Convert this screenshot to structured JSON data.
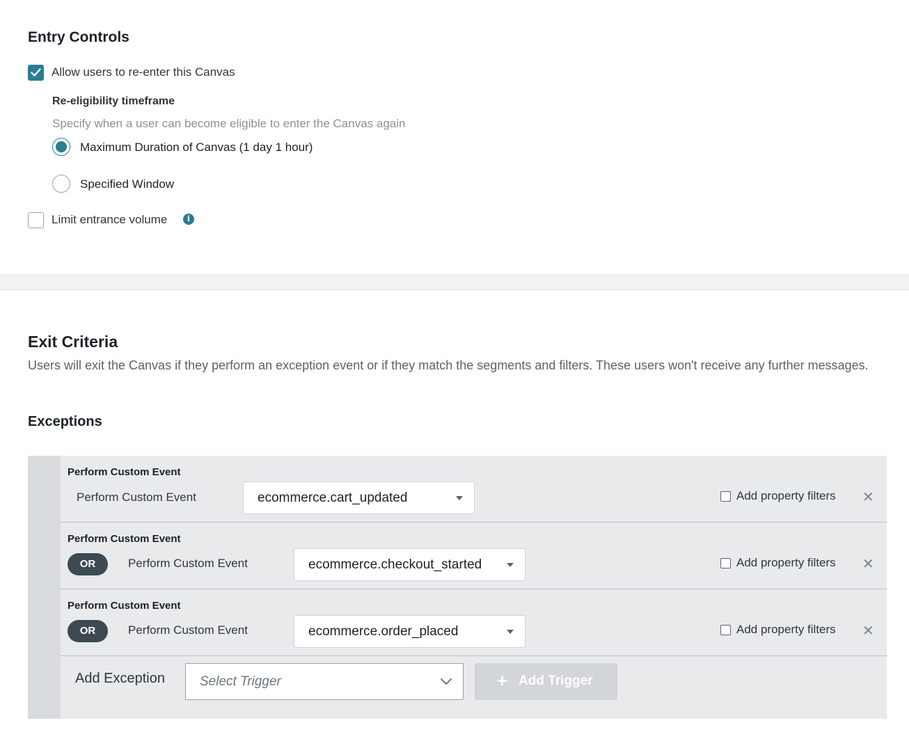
{
  "entry_controls": {
    "title": "Entry Controls",
    "reenter_label": "Allow users to re-enter this Canvas",
    "reenter_checked": true,
    "reeligibility_title": "Re-eligibility timeframe",
    "reeligibility_desc": "Specify when a user can become eligible to enter the Canvas again",
    "options": [
      {
        "label": "Maximum Duration of Canvas (1 day 1 hour)",
        "selected": true
      },
      {
        "label": "Specified Window",
        "selected": false
      }
    ],
    "limit_label": "Limit entrance volume",
    "limit_checked": false,
    "info_icon": "info-icon"
  },
  "exit_criteria": {
    "title": "Exit Criteria",
    "description": "Users will exit the Canvas if they perform an exception event or if they match the segments and filters. These users won't receive any further messages.",
    "exceptions_title": "Exceptions",
    "rows": [
      {
        "title": "Perform Custom Event",
        "or": "",
        "label": "Perform Custom Event",
        "event": "ecommerce.cart_updated",
        "prop_label": "Add property filters"
      },
      {
        "title": "Perform Custom Event",
        "or": "OR",
        "label": "Perform Custom Event",
        "event": "ecommerce.checkout_started",
        "prop_label": "Add property filters"
      },
      {
        "title": "Perform Custom Event",
        "or": "OR",
        "label": "Perform Custom Event",
        "event": "ecommerce.order_placed",
        "prop_label": "Add property filters"
      }
    ],
    "add_exception_label": "Add Exception",
    "trigger_placeholder": "Select Trigger",
    "add_trigger_label": "Add Trigger",
    "add_trigger_plus": "+"
  },
  "colors": {
    "accent": "#2b7d93",
    "pill": "#3d4a52",
    "disabled_button": "#d2d6da"
  }
}
